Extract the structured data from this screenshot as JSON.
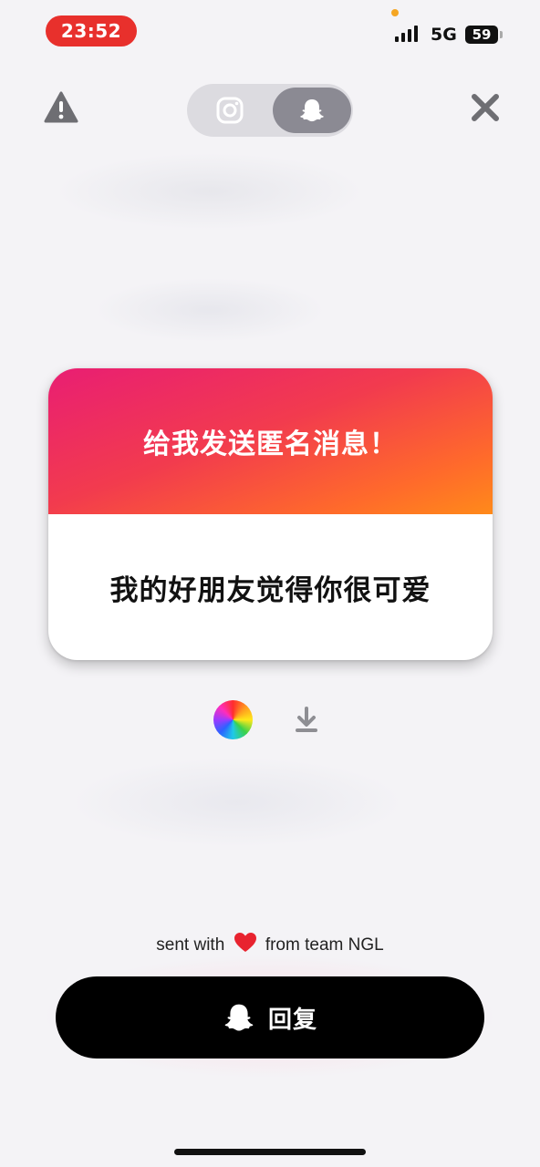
{
  "status_bar": {
    "time": "23:52",
    "network": "5G",
    "battery": "59"
  },
  "top_bar": {
    "left_icon": "warning-icon",
    "toggle_options": [
      "instagram-icon",
      "snapchat-ghost-icon"
    ],
    "toggle_selected": "snapchat-ghost-icon",
    "right_icon": "close-icon"
  },
  "card": {
    "title": "给我发送匿名消息！",
    "message": "我的好朋友觉得你很可爱"
  },
  "actions": {
    "icons": [
      "color-wheel-icon",
      "download-icon"
    ]
  },
  "footer": {
    "sent_prefix": "sent with",
    "sent_suffix": "from team NGL",
    "reply_label": "回复"
  },
  "colors": {
    "gradient_start": "#e91e73",
    "gradient_end": "#ff8a1a",
    "time_pill": "#e8302c",
    "button": "#000000"
  }
}
